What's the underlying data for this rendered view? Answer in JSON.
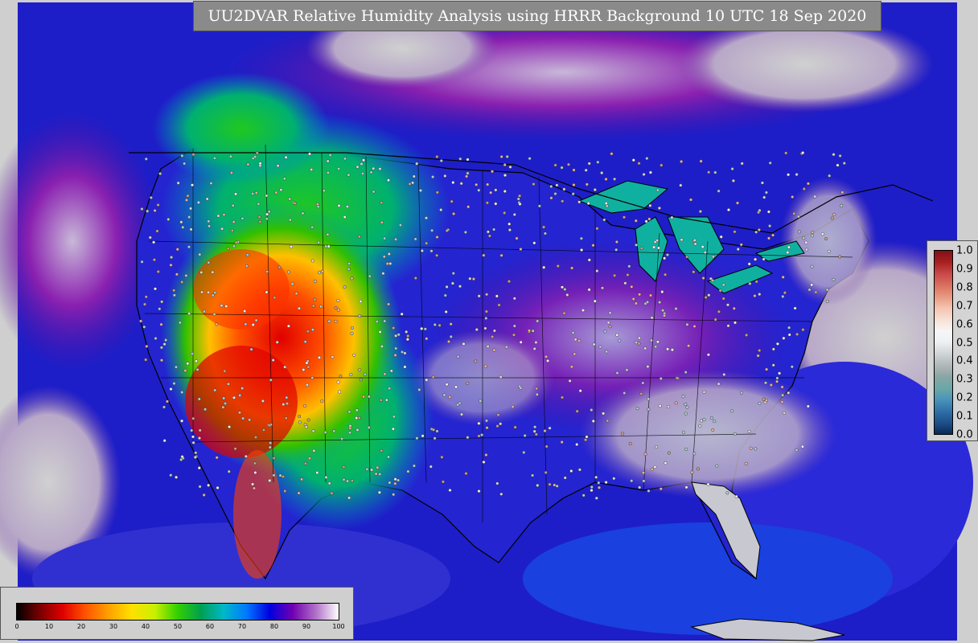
{
  "title": "UU2DVAR Relative Humidity Analysis using HRRR Background 10 UTC 18 Sep 2020",
  "rh_colorbar": {
    "ticks": [
      "0",
      "10",
      "20",
      "30",
      "40",
      "50",
      "60",
      "70",
      "80",
      "90",
      "100"
    ],
    "colors": [
      "#000000",
      "#7a0000",
      "#e00000",
      "#ff5500",
      "#ffa000",
      "#ffe000",
      "#c8f000",
      "#30d000",
      "#00a050",
      "#00b8c8",
      "#0078ff",
      "#0000e0",
      "#7000b0",
      "#b070c8",
      "#ffffff"
    ]
  },
  "increment_colorbar": {
    "ticks": [
      "1.0",
      "0.9",
      "0.8",
      "0.7",
      "0.6",
      "0.5",
      "0.4",
      "0.3",
      "0.2",
      "0.1",
      "0.0"
    ],
    "colors": [
      "#0a2a55",
      "#1f4f8a",
      "#2f70a8",
      "#4a93b8",
      "#6aa8a8",
      "#8aa4a4",
      "#b0b8b8",
      "#d0d4d8",
      "#eef0f2",
      "#f6f6f6",
      "#f8e0d4",
      "#f4c4b0",
      "#e89880",
      "#d87060",
      "#c84848",
      "#a82020",
      "#801018"
    ]
  }
}
